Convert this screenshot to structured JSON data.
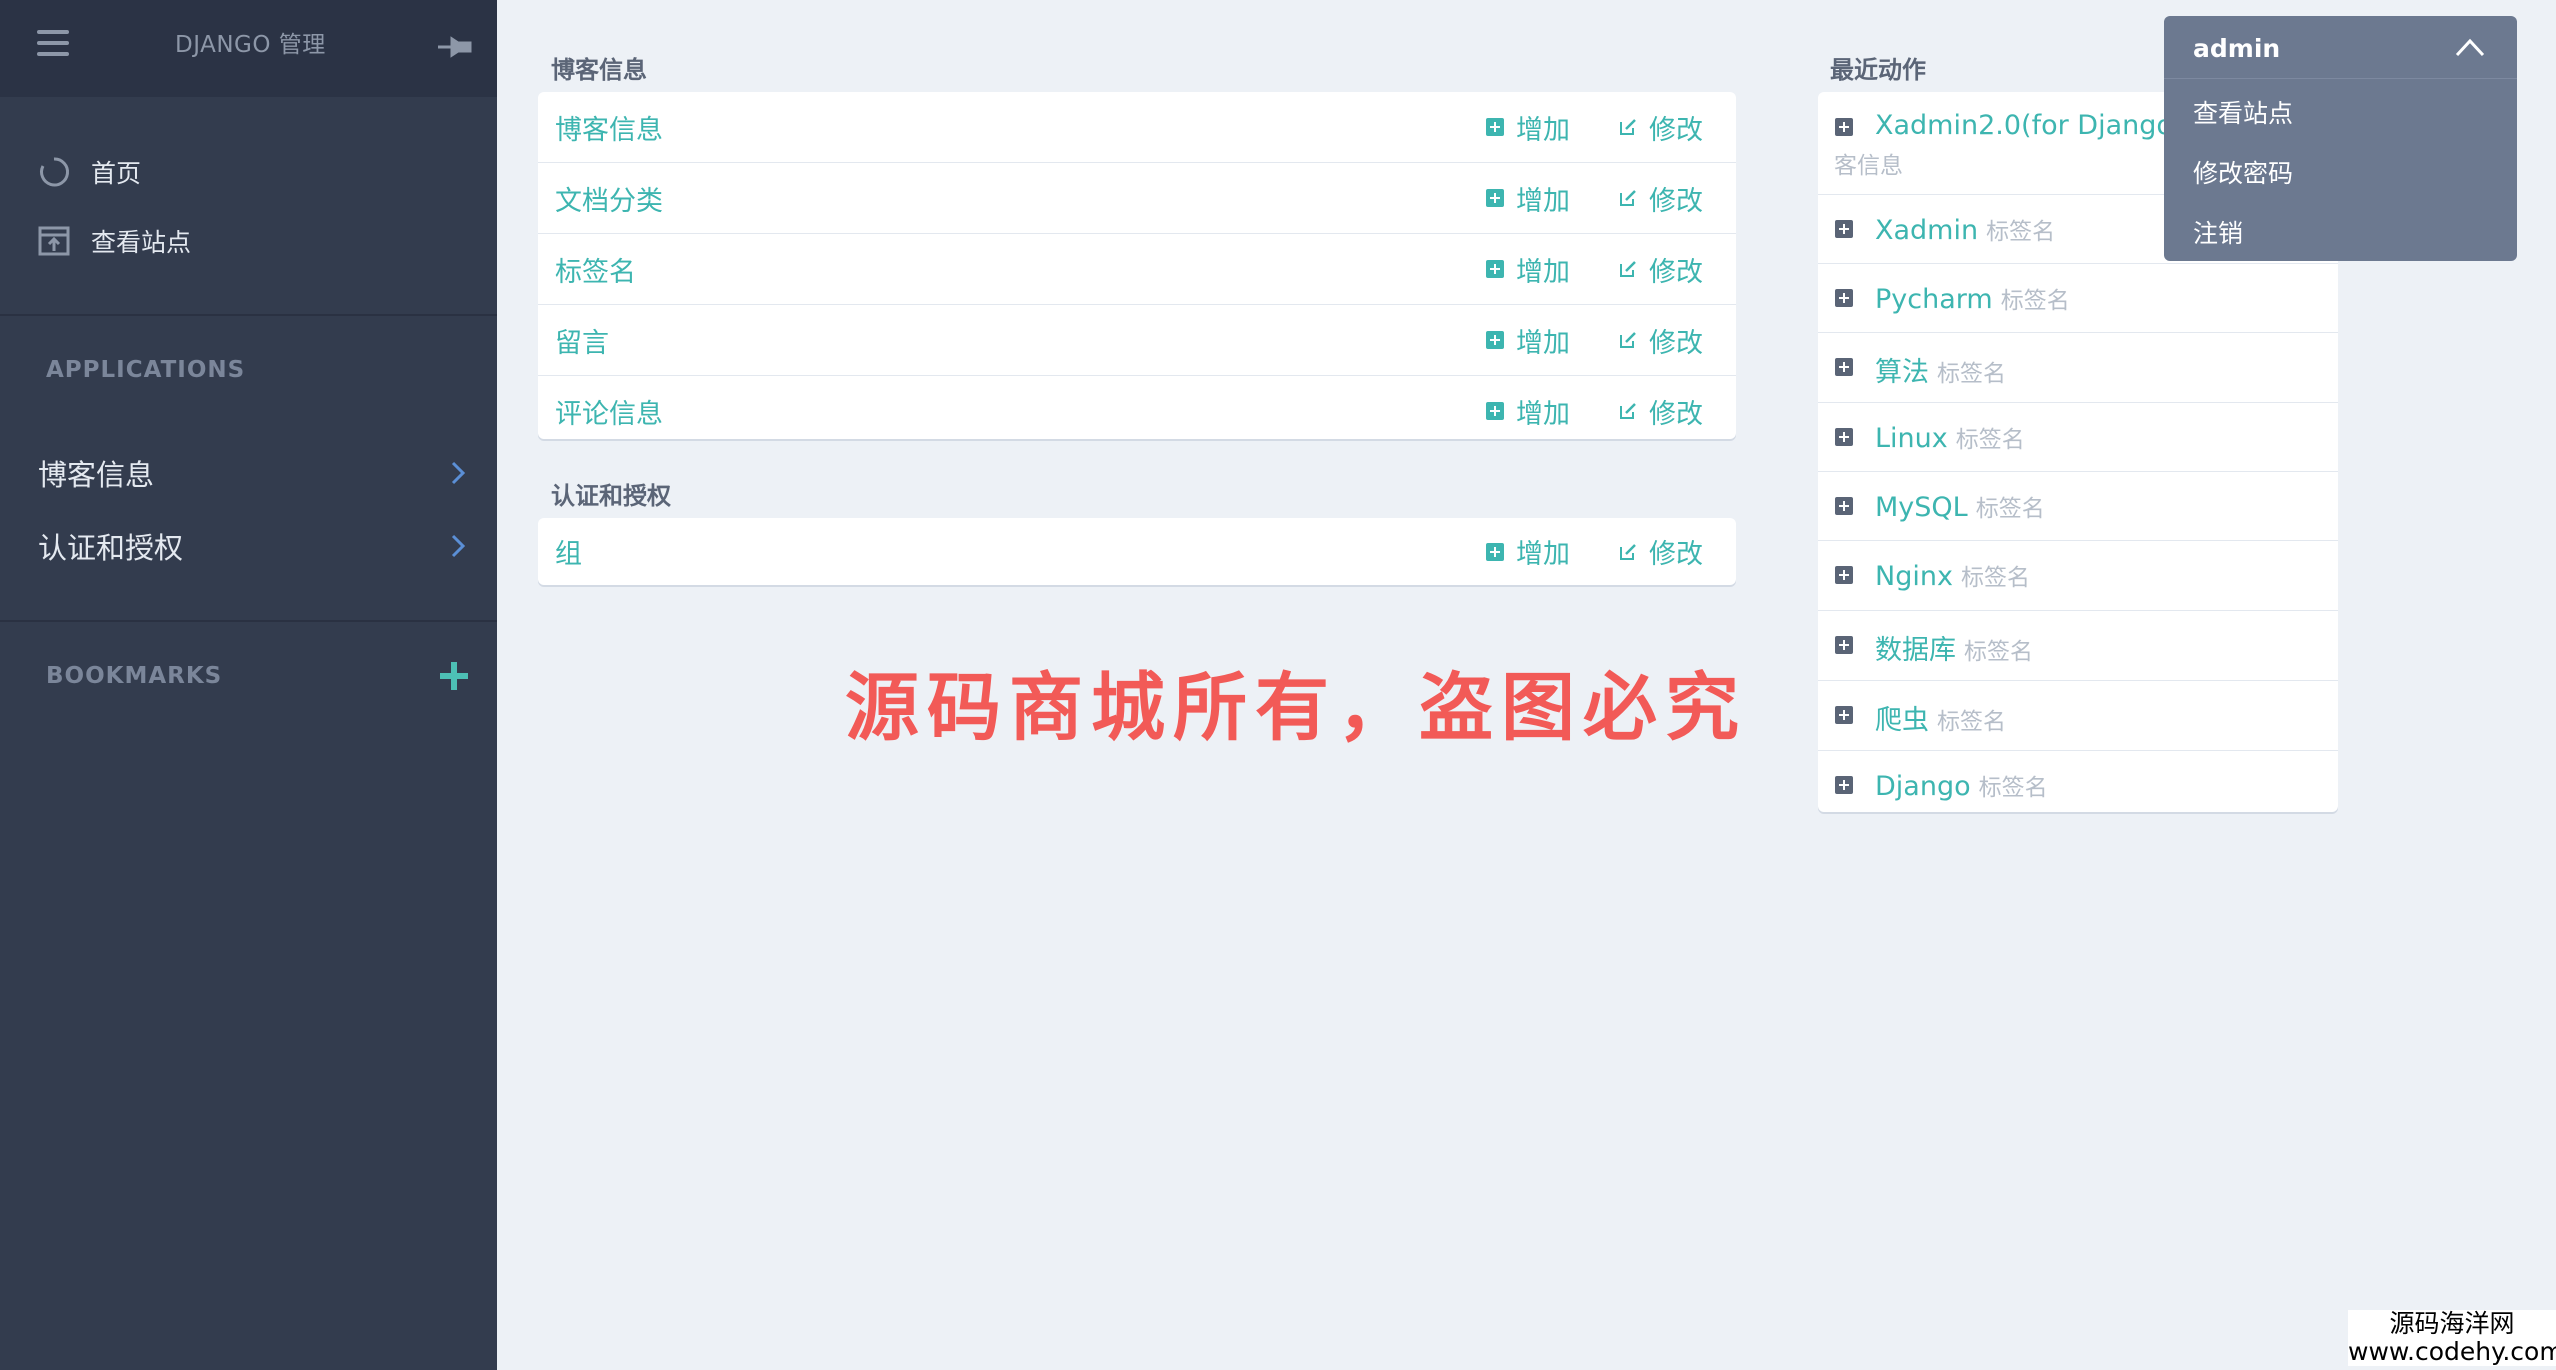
{
  "sidebar": {
    "brand": "DJANGO 管理",
    "nav": [
      {
        "label": "首页",
        "icon": "home-circle-icon"
      },
      {
        "label": "查看站点",
        "icon": "view-site-icon"
      }
    ],
    "applications_title": "APPLICATIONS",
    "apps": [
      {
        "label": "博客信息"
      },
      {
        "label": "认证和授权"
      }
    ],
    "bookmarks_title": "BOOKMARKS"
  },
  "main": {
    "blog_section": {
      "title": "博客信息",
      "rows": [
        {
          "name": "博客信息",
          "add": "增加",
          "change": "修改"
        },
        {
          "name": "文档分类",
          "add": "增加",
          "change": "修改"
        },
        {
          "name": "标签名",
          "add": "增加",
          "change": "修改"
        },
        {
          "name": "留言",
          "add": "增加",
          "change": "修改"
        },
        {
          "name": "评论信息",
          "add": "增加",
          "change": "修改"
        }
      ]
    },
    "auth_section": {
      "title": "认证和授权",
      "rows": [
        {
          "name": "组",
          "add": "增加",
          "change": "修改"
        }
      ]
    }
  },
  "recent": {
    "title": "最近动作",
    "items": [
      {
        "title": "Xadmin2.0(for Django2.0",
        "type": "",
        "sub": "客信息"
      },
      {
        "title": "Xadmin",
        "type": "标签名"
      },
      {
        "title": "Pycharm",
        "type": "标签名"
      },
      {
        "title": "算法",
        "type": "标签名"
      },
      {
        "title": "Linux",
        "type": "标签名"
      },
      {
        "title": "MySQL",
        "type": "标签名"
      },
      {
        "title": "Nginx",
        "type": "标签名"
      },
      {
        "title": "数据库",
        "type": "标签名"
      },
      {
        "title": "爬虫",
        "type": "标签名"
      },
      {
        "title": "Django",
        "type": "标签名"
      }
    ]
  },
  "user_menu": {
    "username": "admin",
    "items": [
      "查看站点",
      "修改密码",
      "注销"
    ]
  },
  "watermark": "源码商城所有，盗图必究",
  "corner_watermark": {
    "line1": "源码海洋网",
    "line2": "www.codehy.com"
  },
  "colors": {
    "sidebar_bg": "#333c4e",
    "accent": "#3db5b0",
    "dropdown_bg": "#6c7990",
    "watermark": "#f25a57"
  }
}
